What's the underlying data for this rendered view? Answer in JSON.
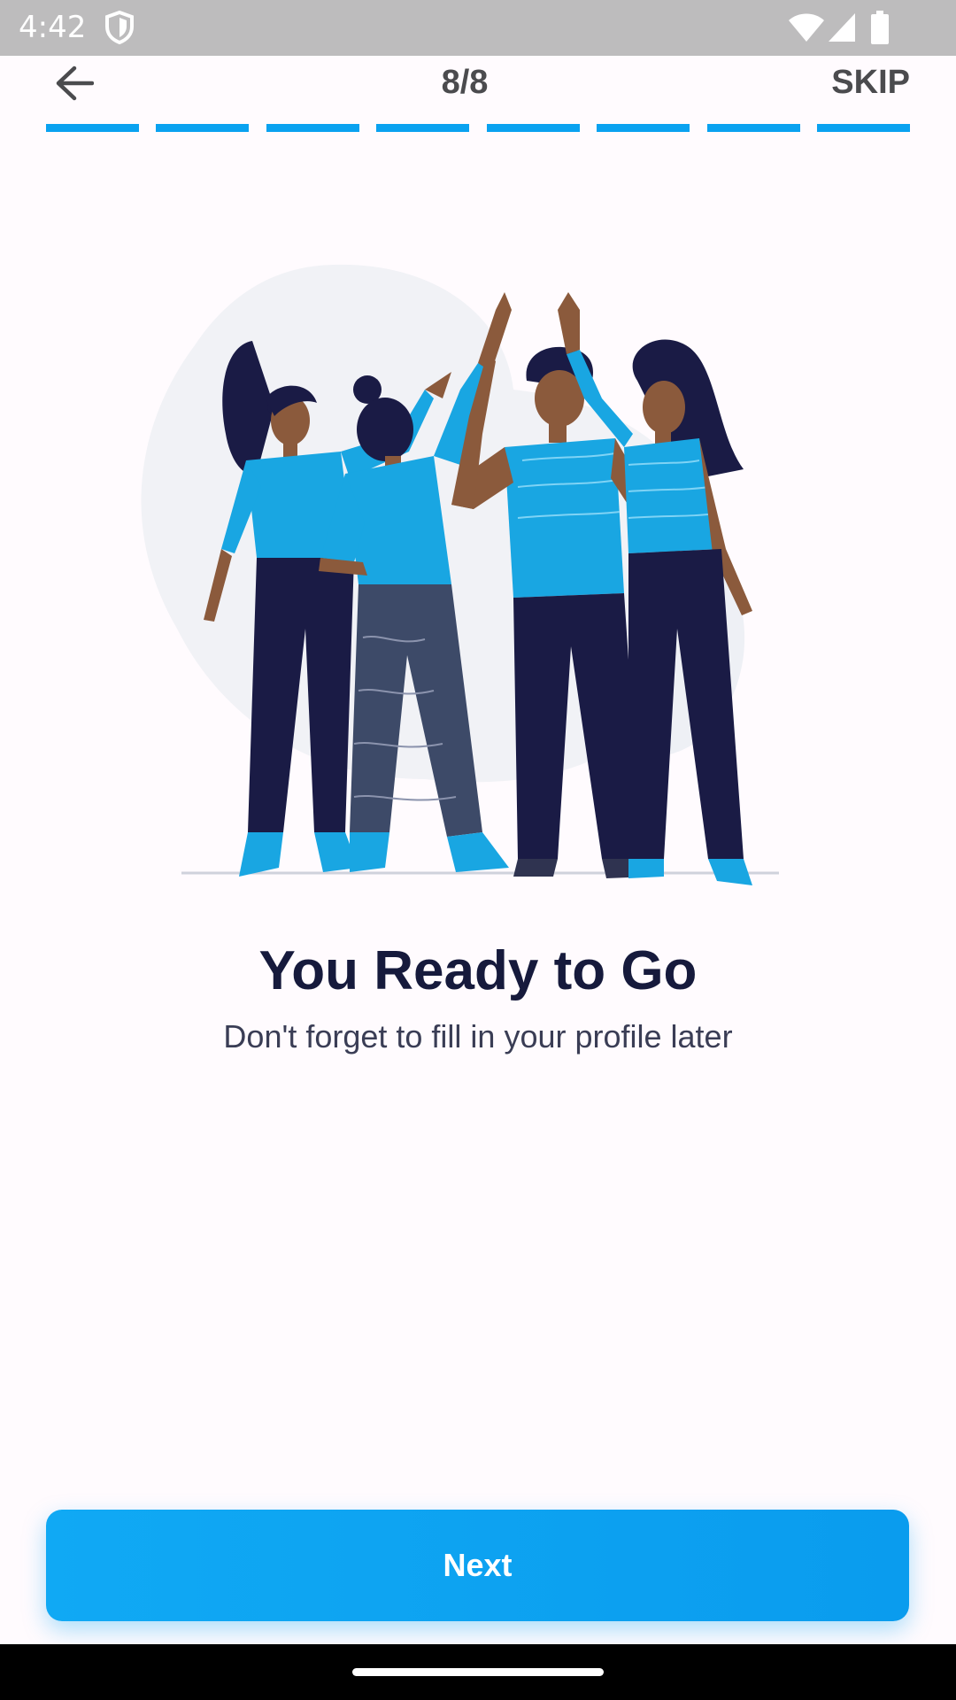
{
  "status_bar": {
    "time": "4:42",
    "icons": [
      "shield-icon",
      "wifi-icon",
      "signal-icon",
      "battery-icon"
    ]
  },
  "header": {
    "back_icon": "arrow-left-icon",
    "step": "8/8",
    "skip_label": "SKIP"
  },
  "progress": {
    "total_steps": 8,
    "completed_steps": 8,
    "color": "#0aa2f0"
  },
  "illustration": {
    "icon": "team-high-five-illustration"
  },
  "content": {
    "title": "You Ready to Go",
    "subtitle": "Don't forget to fill in your profile later"
  },
  "footer": {
    "next_label": "Next",
    "accent_color": "#10a9f4"
  }
}
